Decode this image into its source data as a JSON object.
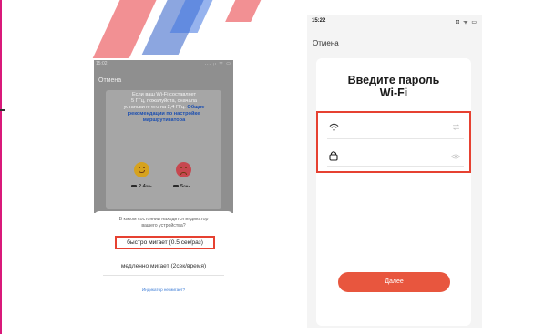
{
  "left_phone": {
    "status_time": "15:02",
    "status_icons": "... ᵢₗ ᯤ ▭",
    "cancel": "Отмена",
    "info": {
      "line1": "Если ваш Wi-Fi составляет",
      "line2": "5 ГГц, пожалуйста, сначала",
      "line3": "установите его на 2,4 ГГц.",
      "link1": "Общие",
      "link2": "рекомендации по настройке",
      "link3": "маршрутизатора"
    },
    "freq_24": "2.4",
    "freq_24_unit": "GHz",
    "freq_5": "5",
    "freq_5_unit": "GHz",
    "question_line1": "В каком состоянии находится индикатор",
    "question_line2": "вашего устройства?",
    "option_fast": "быстро мигает (0.5 сек/раз)",
    "option_slow": "медленно мигает (2сек/время)",
    "indicator_link": "Индикатор не мигает?"
  },
  "right_phone": {
    "status_time": "15:22",
    "status_icons": "⊡ ᯤ ▭",
    "cancel": "Отмена",
    "title_line1": "Введите пароль",
    "title_line2": "Wi-Fi",
    "next_button": "Далее"
  },
  "colors": {
    "accent": "#e8563e",
    "highlight_border": "#e64131",
    "link": "#3b7bd6",
    "frame_bar": "#d9197a"
  },
  "icons": {
    "wifi": "wifi-icon",
    "lock": "lock-icon",
    "switch": "switch-icon",
    "eye": "eye-icon",
    "happy": "happy-face-icon",
    "sad": "sad-face-icon",
    "router": "router-icon"
  }
}
